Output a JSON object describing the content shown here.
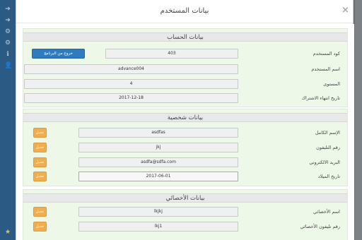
{
  "sidebar": {
    "icons": [
      "arrow-right-icon",
      "arrow-right-icon",
      "gear-icon",
      "gear-icon",
      "info-icon",
      "user-icon",
      "star-icon"
    ]
  },
  "modal": {
    "title": "بيانات المستخدم",
    "close_glyph": "×"
  },
  "account": {
    "title": "بيانات الحساب",
    "exit_label": "خروج من البرنامج",
    "fields": [
      {
        "label": "كود المستخدم",
        "value": "403"
      },
      {
        "label": "اسم المستخدم",
        "value": "advance004"
      },
      {
        "label": "المستوى",
        "value": "4"
      },
      {
        "label": "تاريخ انتهاء الاشتراك",
        "value": "2017-12-18"
      }
    ]
  },
  "personal": {
    "title": "بيانات شخصية",
    "edit_label": "تعديل",
    "fields": [
      {
        "label": "الإسم الكامل",
        "value": "asdfas"
      },
      {
        "label": "رقم التليفون",
        "value": "jkj"
      },
      {
        "label": "البريد الالكتروني",
        "value": "asdfa@sdfa.com"
      },
      {
        "label": "تاريخ الميلاد",
        "value": "2017-06-01"
      }
    ]
  },
  "specialist": {
    "title": "بيانات الأخصائي",
    "edit_label": "تعديل",
    "fields": [
      {
        "label": "اسم الأخصائي",
        "value": "lkjkj"
      },
      {
        "label": "رقم تليفون الأخصائي",
        "value": "lkj1"
      }
    ]
  }
}
